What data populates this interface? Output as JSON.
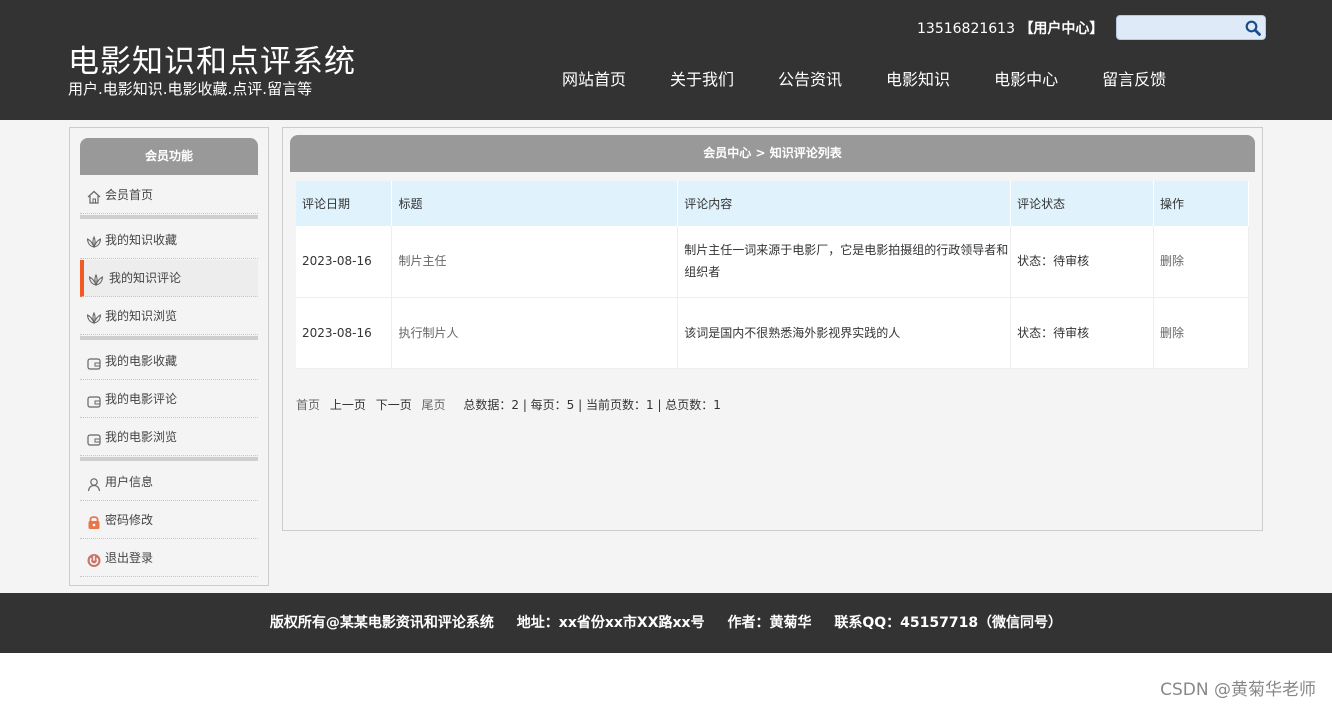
{
  "header": {
    "title": "电影知识和点评系统",
    "subtitle": "用户.电影知识.电影收藏.点评.留言等",
    "phone": "13516821613",
    "user_center_link": "【用户中心】",
    "search_placeholder": ""
  },
  "nav": [
    "网站首页",
    "关于我们",
    "公告资讯",
    "电影知识",
    "电影中心",
    "留言反馈"
  ],
  "sidebar": {
    "title": "会员功能",
    "items": [
      {
        "label": "会员首页",
        "icon": "home-icon"
      },
      {
        "label": "我的知识收藏",
        "icon": "lotus-icon"
      },
      {
        "label": "我的知识评论",
        "icon": "lotus-icon",
        "active": true
      },
      {
        "label": "我的知识浏览",
        "icon": "lotus-icon"
      },
      {
        "label": "我的电影收藏",
        "icon": "wallet-icon"
      },
      {
        "label": "我的电影评论",
        "icon": "wallet-icon"
      },
      {
        "label": "我的电影浏览",
        "icon": "wallet-icon"
      },
      {
        "label": "用户信息",
        "icon": "user-icon"
      },
      {
        "label": "密码修改",
        "icon": "lock-icon"
      },
      {
        "label": "退出登录",
        "icon": "power-icon"
      }
    ]
  },
  "content": {
    "breadcrumb": "会员中心 > 知识评论列表",
    "columns": [
      "评论日期",
      "标题",
      "评论内容",
      "评论状态",
      "操作"
    ],
    "rows": [
      {
        "date": "2023-08-16",
        "title": "制片主任",
        "content": "制片主任一词来源于电影厂，它是电影拍摄组的行政领导者和组织者",
        "status": "状态：待审核",
        "action": "删除"
      },
      {
        "date": "2023-08-16",
        "title": "执行制片人",
        "content": "该词是国内不很熟悉海外影视界实践的人",
        "status": "状态：待审核",
        "action": "删除"
      }
    ],
    "pager": {
      "first": "首页",
      "prev": "上一页",
      "next": "下一页",
      "last": "尾页",
      "summary": "总数据：2 | 每页：5 | 当前页数：1 | 总页数：1"
    }
  },
  "footer": {
    "copyright": "版权所有@某某电影资讯和评论系统",
    "address": "地址：xx省份xx市XX路xx号",
    "author": "作者：黄菊华",
    "contact": "联系QQ：45157718（微信同号）"
  },
  "watermark": "CSDN @黄菊华老师",
  "colors": {
    "header_bg": "#333333",
    "active_accent": "#f15a24",
    "panel_head": "#999999",
    "table_head": "#e0f2fb"
  }
}
